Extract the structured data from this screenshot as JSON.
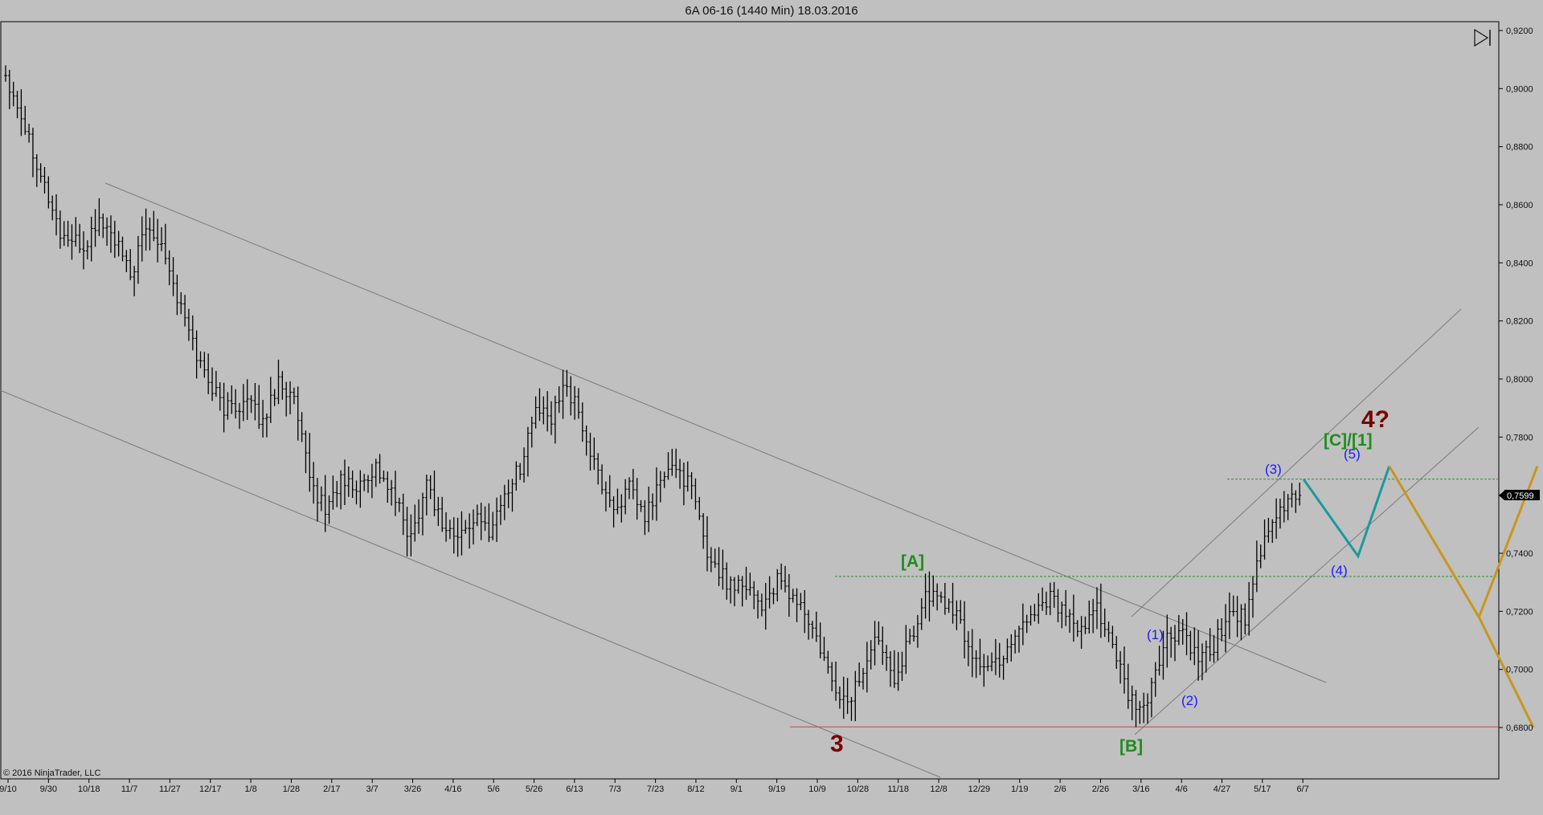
{
  "window": {
    "title": "6A 06-16 (1440 Min)  18.03.2016",
    "copyright": "© 2016 NinjaTrader, LLC"
  },
  "colors": {
    "background": "#c0c0c0",
    "bars": "#000000",
    "channel_lines": "#7a7a7a",
    "green_level": "#2e8b2e",
    "red_level": "#d04050",
    "wave_blue": "#1a1aff",
    "wave_green": "#1e8c1e",
    "wave_darkred": "#7a0000",
    "teal_path": "#1a9a9a",
    "gold_path": "#c8961e",
    "price_label_bg": "#000000",
    "price_label_text": "#ffffff"
  },
  "icons": {
    "toggle": "play-bar-icon"
  },
  "chart_data": {
    "type": "ohlc",
    "title": "6A 06-16 (1440 Min)  18.03.2016",
    "ylim": [
      0.66,
      0.925
    ],
    "y_ticks": [
      "0,9200",
      "0,9000",
      "0,8800",
      "0,8600",
      "0,8400",
      "0,8200",
      "0,8000",
      "0,7800",
      "0,7600",
      "0,7400",
      "0,7200",
      "0,7000",
      "0,6800"
    ],
    "y_tick_values": [
      0.92,
      0.9,
      0.88,
      0.86,
      0.84,
      0.82,
      0.8,
      0.78,
      0.76,
      0.74,
      0.72,
      0.7,
      0.68
    ],
    "x_ticks": [
      "9/10",
      "9/30",
      "10/18",
      "11/7",
      "11/27",
      "12/17",
      "1/8",
      "1/28",
      "2/17",
      "3/7",
      "3/26",
      "4/16",
      "5/6",
      "5/26",
      "6/13",
      "7/3",
      "7/23",
      "8/12",
      "9/1",
      "9/19",
      "10/9",
      "10/28",
      "11/18",
      "12/8",
      "12/29",
      "1/19",
      "2/6",
      "2/26",
      "3/16",
      "4/6",
      "4/27",
      "5/17",
      "6/7"
    ],
    "last_price": 0.7599,
    "last_price_label": "0,7599",
    "anchors": [
      [
        0,
        0.905
      ],
      [
        3,
        0.895
      ],
      [
        8,
        0.875
      ],
      [
        14,
        0.85
      ],
      [
        20,
        0.845
      ],
      [
        24,
        0.855
      ],
      [
        28,
        0.848
      ],
      [
        32,
        0.835
      ],
      [
        36,
        0.852
      ],
      [
        40,
        0.848
      ],
      [
        44,
        0.828
      ],
      [
        50,
        0.805
      ],
      [
        56,
        0.79
      ],
      [
        62,
        0.792
      ],
      [
        66,
        0.785
      ],
      [
        70,
        0.8
      ],
      [
        74,
        0.792
      ],
      [
        78,
        0.765
      ],
      [
        82,
        0.755
      ],
      [
        86,
        0.765
      ],
      [
        90,
        0.762
      ],
      [
        95,
        0.77
      ],
      [
        100,
        0.758
      ],
      [
        104,
        0.745
      ],
      [
        108,
        0.765
      ],
      [
        112,
        0.75
      ],
      [
        116,
        0.745
      ],
      [
        120,
        0.752
      ],
      [
        124,
        0.748
      ],
      [
        128,
        0.76
      ],
      [
        132,
        0.77
      ],
      [
        136,
        0.79
      ],
      [
        140,
        0.785
      ],
      [
        143,
        0.8
      ],
      [
        147,
        0.788
      ],
      [
        151,
        0.77
      ],
      [
        156,
        0.755
      ],
      [
        160,
        0.762
      ],
      [
        164,
        0.752
      ],
      [
        168,
        0.765
      ],
      [
        172,
        0.77
      ],
      [
        176,
        0.762
      ],
      [
        180,
        0.74
      ],
      [
        185,
        0.73
      ],
      [
        190,
        0.73
      ],
      [
        194,
        0.722
      ],
      [
        198,
        0.73
      ],
      [
        204,
        0.722
      ],
      [
        208,
        0.71
      ],
      [
        212,
        0.695
      ],
      [
        216,
        0.688
      ],
      [
        220,
        0.7
      ],
      [
        224,
        0.712
      ],
      [
        228,
        0.698
      ],
      [
        232,
        0.71
      ],
      [
        236,
        0.725
      ],
      [
        240,
        0.725
      ],
      [
        244,
        0.718
      ],
      [
        248,
        0.705
      ],
      [
        252,
        0.7
      ],
      [
        256,
        0.705
      ],
      [
        260,
        0.715
      ],
      [
        264,
        0.72
      ],
      [
        268,
        0.726
      ],
      [
        272,
        0.718
      ],
      [
        276,
        0.712
      ],
      [
        280,
        0.722
      ],
      [
        284,
        0.708
      ],
      [
        288,
        0.69
      ],
      [
        292,
        0.685
      ],
      [
        295,
        0.7
      ],
      [
        298,
        0.71
      ],
      [
        302,
        0.713
      ],
      [
        306,
        0.702
      ],
      [
        310,
        0.708
      ],
      [
        314,
        0.72
      ],
      [
        318,
        0.718
      ],
      [
        322,
        0.74
      ],
      [
        326,
        0.752
      ],
      [
        330,
        0.76
      ],
      [
        332,
        0.7599
      ]
    ]
  },
  "annotations": {
    "wave_3": "3",
    "wave_A": "[A]",
    "wave_B": "[B]",
    "wave_C1": "[C]/[1]",
    "wave_4q": "4?",
    "sub_1": "(1)",
    "sub_2": "(2)",
    "sub_3": "(3)",
    "sub_4": "(4)",
    "sub_5": "(5)"
  },
  "levels": {
    "green_high": 0.732,
    "green_mid": 0.7655,
    "red_low": 0.6802
  },
  "projections": {
    "teal": [
      [
        333,
        0.7655
      ],
      [
        347,
        0.739
      ],
      [
        355,
        0.77
      ]
    ],
    "gold_down": [
      [
        355,
        0.77
      ],
      [
        378,
        0.718
      ],
      [
        392,
        0.68
      ]
    ],
    "gold_up": [
      [
        378,
        0.718
      ],
      [
        393,
        0.77
      ]
    ]
  }
}
